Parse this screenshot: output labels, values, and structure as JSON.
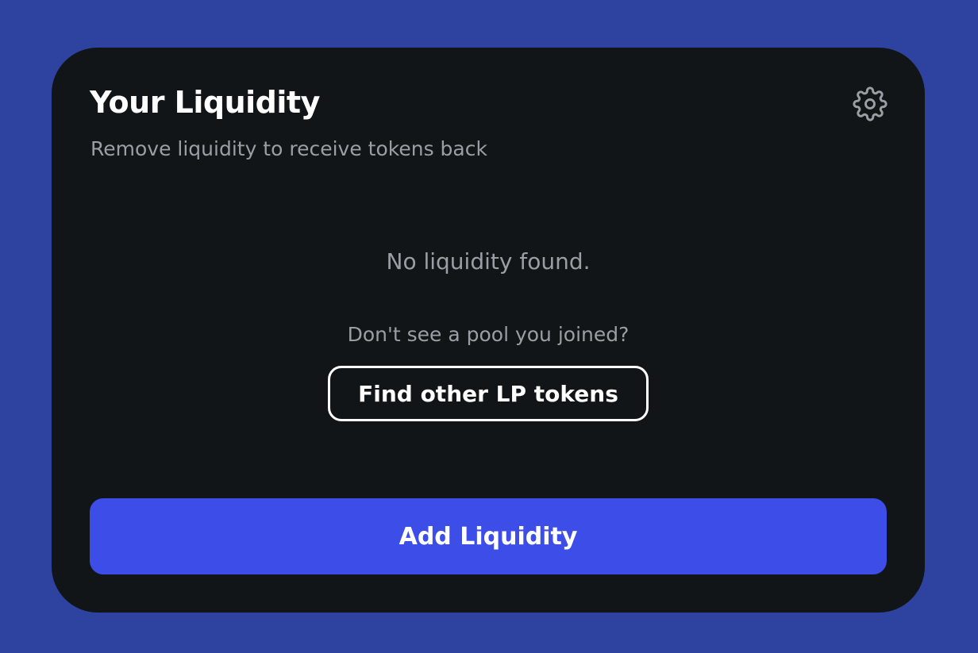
{
  "colors": {
    "page_background": "#2e43a0",
    "card_background": "#111517",
    "muted_text": "#9a9fa6",
    "primary_button": "#3c4de8",
    "text_primary": "#ffffff"
  },
  "header": {
    "title": "Your Liquidity",
    "subtitle": "Remove liquidity to receive tokens back",
    "settings_icon": "gear-icon"
  },
  "body": {
    "empty_message": "No liquidity found.",
    "hint": "Don't see a pool you joined?",
    "find_button_label": "Find other LP tokens"
  },
  "footer": {
    "add_button_label": "Add Liquidity"
  }
}
